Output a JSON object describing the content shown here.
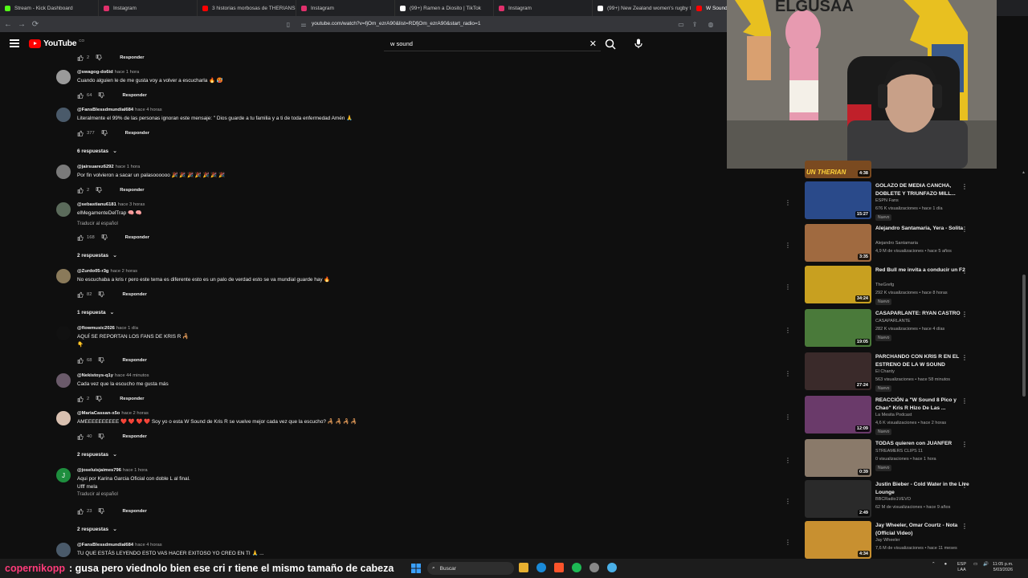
{
  "browser": {
    "tabs": [
      {
        "label": "Stream - Kick Dashboard",
        "color": "#53fc18",
        "active": false
      },
      {
        "label": "Instagram",
        "color": "#e1306c",
        "active": false
      },
      {
        "label": "3 historias morbosas de THERIANS",
        "color": "#ff0000",
        "active": false
      },
      {
        "label": "Instagram",
        "color": "#e1306c",
        "active": false
      },
      {
        "label": "(99+) Ramen a Diosito | TikTok",
        "color": "#ffffff",
        "active": false
      },
      {
        "label": "Instagram",
        "color": "#e1306c",
        "active": false
      },
      {
        "label": "(99+) New Zealand women's rugby te",
        "color": "#ffffff",
        "active": false
      },
      {
        "label": "W Sound",
        "color": "#ff0000",
        "active": true
      }
    ],
    "url": "youtube.com/watch?v=fjOm_ezrA90&list=RDfjOm_ezrA90&start_radio=1"
  },
  "youtube": {
    "logo_text": "YouTube",
    "logo_country": "CO",
    "search_value": "w sound"
  },
  "comments": [
    {
      "user": "",
      "time": "",
      "text": "",
      "likes": "2",
      "reply": "Responder",
      "avatar": "#555"
    },
    {
      "user": "@swagog-do6id",
      "time": "hace 1 hora",
      "text": "Cuando alguien le de me gusta voy a volver a escucharla 🔥 🥵",
      "likes": "64",
      "reply": "Responder",
      "avatar": "#9a9a9a"
    },
    {
      "user": "@FansBlessdmundial684",
      "time": "hace 4 horas",
      "text": "Literalmente el 99% de las personas ignoran este mensaje: \" Dios guarde a tu familia y a ti de toda enfermedad Amén 🙏",
      "likes": "377",
      "reply": "Responder",
      "replies": "6 respuestas",
      "avatar": "#4a5a6a"
    },
    {
      "user": "@jairsuarez6292",
      "time": "hace 1 hora",
      "text": "Por fin volvieron a sacar un palasoooooo 🎉 🎉 🎉 🎉 🎉 🎉 🎉",
      "likes": "2",
      "reply": "Responder",
      "avatar": "#7a7a7a"
    },
    {
      "user": "@sebastianu6181",
      "time": "hace 3 horas",
      "text": "elMegamenteDelTrap 🧠 🧠",
      "translate": "Traducir al español",
      "likes": "168",
      "reply": "Responder",
      "replies": "2 respuestas",
      "avatar": "#5b6b5b"
    },
    {
      "user": "@Zurdo05-r3g",
      "time": "hace 2 horas",
      "text": "No escuchaba a kris r pero este tema es diferente esto es un palo de verdad esto se va mundial guarde hay 🔥",
      "likes": "82",
      "reply": "Responder",
      "replies": "1 respuesta",
      "avatar": "#8a7a5a"
    },
    {
      "user": "@flowmusic2026",
      "time": "hace 1 día",
      "text": "AQUÍ SE REPORTAN LOS FANS DE KRIS R 🦂",
      "text2": "👇",
      "likes": "68",
      "reply": "Responder",
      "avatar": "#111111"
    },
    {
      "user": "@Nekistoys-q1y",
      "time": "hace 44 minutos",
      "text": "Cada vez que la escucho me gusta más",
      "likes": "2",
      "reply": "Responder",
      "avatar": "#6a5a6a"
    },
    {
      "user": "@MariaCassan-x5o",
      "time": "hace 2 horas",
      "text": "AMEEEEEEEEEE ❤️ ❤️ ❤️ ❤️ Soy yo o esta W Sound de Kris R se vuelve mejor cada vez que la escucho? 🦂 🦂 🦂 🦂",
      "likes": "40",
      "reply": "Responder",
      "replies": "2 respuestas",
      "avatar": "#d8c0b0"
    },
    {
      "user": "@joseluisjaimes796",
      "time": "hace 1 hora",
      "text": "Aqui por Karina Garcia Oficial con doble L al final.",
      "text2": "Ufff mela",
      "translate": "Traducir al español",
      "likes": "23",
      "reply": "Responder",
      "replies": "2 respuestas",
      "avatar": "#1e8e3e",
      "initial": "J"
    },
    {
      "user": "@FansBlessdmundial684",
      "time": "hace 4 horas",
      "text": "TU QUE ESTÁS LEYENDO ESTO VAS HACER EXITOSO YO CREO EN TI 🙏 ...",
      "avatar": "#4a5a6a"
    }
  ],
  "sidebar": {
    "top_partial": {
      "title": "UN THERIAN",
      "duration": "4:38"
    },
    "items": [
      {
        "title": "GOLAZO DE MEDIA CANCHA, DOBLETE Y TRIUNFAZO MILL...",
        "channel": "ESPN Fans",
        "meta": "676 K visualizaciones • hace 1 día",
        "badge": "Nuevo",
        "duration": "15:27",
        "thumb": "#2a4a8a"
      },
      {
        "title": "Alejandro Santamaria, Yera - Solita",
        "channel": "Alejandro Santamaria",
        "meta": "4,9 M de visualizaciones • hace 5 años",
        "badge": "",
        "duration": "3:35",
        "thumb": "#a06a40"
      },
      {
        "title": "Red Bull me invita a conducir un F2",
        "channel": "TheGrefg",
        "meta": "292 K visualizaciones • hace 8 horas",
        "badge": "Nuevo",
        "duration": "34:24",
        "thumb": "#c8a020"
      },
      {
        "title": "CASAPARLANTE: RYAN CASTRO",
        "channel": "CASAPARLANTE",
        "meta": "282 K visualizaciones • hace 4 días",
        "badge": "Nuevo",
        "duration": "19:05",
        "thumb": "#4a7a3a"
      },
      {
        "title": "PARCHANDO CON KRIS R EN EL ESTRENO DE LA W SOUND",
        "channel": "El Chanty",
        "meta": "563 visualizaciones • hace 58 minutos",
        "badge": "Nuevo",
        "duration": "27:24",
        "thumb": "#3a2a2a"
      },
      {
        "title": "REACCIÓN a \"W Sound 8 Pico y Chao\" Kris R Hizo De Las ...",
        "channel": "La Mesita Podcast",
        "meta": "4,6 K visualizaciones • hace 2 horas",
        "badge": "Nuevo",
        "duration": "12:09",
        "thumb": "#6a3a6a"
      },
      {
        "title": "TODAS quieren con JUANFER",
        "channel": "STREAMERS CLIPS 11",
        "meta": "0 visualizaciones • hace 1 hora",
        "badge": "Nuevo",
        "duration": "0:39",
        "thumb": "#8a7a6a"
      },
      {
        "title": "Justin Bieber - Cold Water in the Live Lounge",
        "channel": "BBCRadio1VEVO",
        "meta": "62 M de visualizaciones • hace 9 años",
        "badge": "",
        "duration": "2:49",
        "thumb": "#2a2a2a"
      },
      {
        "title": "Jay Wheeler, Omar Courtz - Nota (Official Video)",
        "channel": "Jay Wheeler",
        "meta": "7,6 M de visualizaciones • hace 11 meses",
        "badge": "",
        "duration": "4:34",
        "thumb": "#c89030"
      }
    ]
  },
  "webcam": {
    "banner_text": "ELGUSAA"
  },
  "stream_chat": {
    "user": "copernikopp",
    "message": ": gusa pero viednolo bien ese cri r tiene el mismo tamaño de cabeza"
  },
  "taskbar": {
    "search_placeholder": "Buscar",
    "lang": "ESP",
    "lang2": "LAA",
    "time": "11:05 p.m.",
    "date": "5/03/2026"
  }
}
